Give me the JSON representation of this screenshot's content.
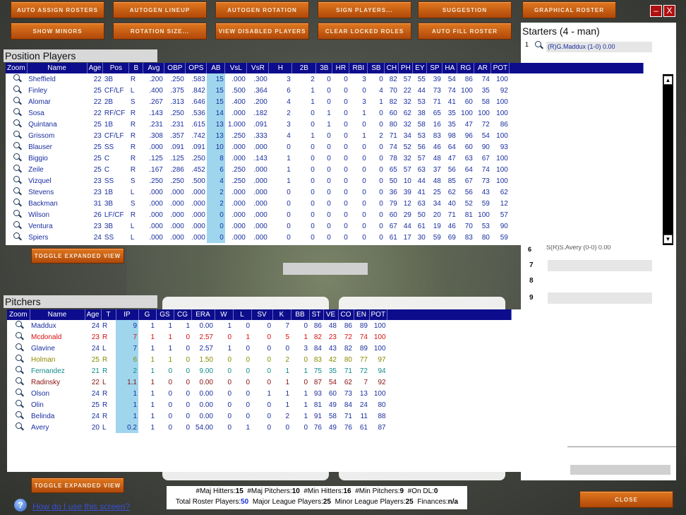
{
  "toolbar": {
    "auto_assign": "Auto Assign Rosters",
    "autogen_lineup": "Autogen Lineup",
    "autogen_rotation": "Autogen Rotation",
    "sign_players": "Sign Players...",
    "suggestion": "Suggestion",
    "graphical_roster": "Graphical Roster",
    "show_minors": "Show Minors",
    "rotation_size": "Rotation Size...",
    "view_disabled": "View Disabled Players",
    "clear_locked": "Clear Locked Roles",
    "auto_fill": "Auto Fill Roster",
    "minimize": "–",
    "close_x": "X"
  },
  "starters": {
    "title": "Starters (4 - man)",
    "first_num": "1",
    "first_text": "(R)G.Maddux  (1-0) 0.00",
    "sixth_num": "6",
    "sixth_text": "S(R)S.Avery  (0-0) 0.00",
    "slots": [
      "7",
      "8",
      "9"
    ]
  },
  "position": {
    "title": "Position Players",
    "headers": [
      "Zoom",
      "Name",
      "Age",
      "Pos",
      "B",
      "Avg",
      "OBP",
      "OPS",
      "AB",
      "VsL",
      "VsR",
      "H",
      "2B",
      "3B",
      "HR",
      "RBI",
      "SB",
      "CH",
      "PH",
      "EY",
      "SP",
      "HA",
      "RG",
      "AR",
      "POT"
    ],
    "rows": [
      [
        "Sheffield",
        "22",
        "3B",
        "R",
        ".200",
        ".250",
        ".583",
        "15",
        ".000",
        ".300",
        "3",
        "2",
        "0",
        "0",
        "3",
        "0",
        "82",
        "57",
        "55",
        "39",
        "54",
        "86",
        "74",
        "100"
      ],
      [
        "Finley",
        "25",
        "CF/LF",
        "L",
        ".400",
        ".375",
        ".842",
        "15",
        ".500",
        ".364",
        "6",
        "1",
        "0",
        "0",
        "0",
        "4",
        "70",
        "22",
        "44",
        "73",
        "74",
        "100",
        "35",
        "92"
      ],
      [
        "Alomar",
        "22",
        "2B",
        "S",
        ".267",
        ".313",
        ".646",
        "15",
        ".400",
        ".200",
        "4",
        "1",
        "0",
        "0",
        "3",
        "1",
        "82",
        "32",
        "53",
        "71",
        "41",
        "60",
        "58",
        "100"
      ],
      [
        "Sosa",
        "22",
        "RF/CF",
        "R",
        ".143",
        ".250",
        ".536",
        "14",
        ".000",
        ".182",
        "2",
        "0",
        "1",
        "0",
        "1",
        "0",
        "60",
        "62",
        "38",
        "65",
        "35",
        "100",
        "100",
        "100"
      ],
      [
        "Quintana",
        "25",
        "1B",
        "R",
        ".231",
        ".231",
        ".615",
        "13",
        "1.000",
        ".091",
        "3",
        "0",
        "1",
        "0",
        "0",
        "0",
        "80",
        "32",
        "58",
        "16",
        "35",
        "47",
        "72",
        "86"
      ],
      [
        "Grissom",
        "23",
        "CF/LF",
        "R",
        ".308",
        ".357",
        ".742",
        "13",
        ".250",
        ".333",
        "4",
        "1",
        "0",
        "0",
        "1",
        "2",
        "71",
        "34",
        "53",
        "83",
        "98",
        "96",
        "54",
        "100"
      ],
      [
        "Blauser",
        "25",
        "SS",
        "R",
        ".000",
        ".091",
        ".091",
        "10",
        ".000",
        ".000",
        "0",
        "0",
        "0",
        "0",
        "0",
        "0",
        "74",
        "52",
        "56",
        "46",
        "64",
        "60",
        "90",
        "93"
      ],
      [
        "Biggio",
        "25",
        "C",
        "R",
        ".125",
        ".125",
        ".250",
        "8",
        ".000",
        ".143",
        "1",
        "0",
        "0",
        "0",
        "0",
        "0",
        "78",
        "32",
        "57",
        "48",
        "47",
        "63",
        "67",
        "100"
      ],
      [
        "Zeile",
        "25",
        "C",
        "R",
        ".167",
        ".286",
        ".452",
        "6",
        ".250",
        ".000",
        "1",
        "0",
        "0",
        "0",
        "0",
        "0",
        "65",
        "57",
        "63",
        "37",
        "56",
        "64",
        "74",
        "100"
      ],
      [
        "Vizquel",
        "23",
        "SS",
        "S",
        ".250",
        ".250",
        ".500",
        "4",
        ".250",
        ".000",
        "1",
        "0",
        "0",
        "0",
        "0",
        "0",
        "50",
        "10",
        "44",
        "48",
        "85",
        "67",
        "73",
        "100"
      ],
      [
        "Stevens",
        "23",
        "1B",
        "L",
        ".000",
        ".000",
        ".000",
        "2",
        ".000",
        ".000",
        "0",
        "0",
        "0",
        "0",
        "0",
        "0",
        "36",
        "39",
        "41",
        "25",
        "62",
        "56",
        "43",
        "62"
      ],
      [
        "Backman",
        "31",
        "3B",
        "S",
        ".000",
        ".000",
        ".000",
        "2",
        ".000",
        ".000",
        "0",
        "0",
        "0",
        "0",
        "0",
        "0",
        "79",
        "12",
        "63",
        "34",
        "40",
        "52",
        "59",
        "12"
      ],
      [
        "Wilson",
        "26",
        "LF/CF",
        "R",
        ".000",
        ".000",
        ".000",
        "0",
        ".000",
        ".000",
        "0",
        "0",
        "0",
        "0",
        "0",
        "0",
        "60",
        "29",
        "50",
        "20",
        "71",
        "81",
        "100",
        "57"
      ],
      [
        "Ventura",
        "23",
        "3B",
        "L",
        ".000",
        ".000",
        ".000",
        "0",
        ".000",
        ".000",
        "0",
        "0",
        "0",
        "0",
        "0",
        "0",
        "67",
        "44",
        "61",
        "19",
        "46",
        "70",
        "53",
        "90"
      ],
      [
        "Spiers",
        "24",
        "SS",
        "L",
        ".000",
        ".000",
        ".000",
        "0",
        ".000",
        ".000",
        "0",
        "0",
        "0",
        "0",
        "0",
        "0",
        "61",
        "17",
        "30",
        "59",
        "69",
        "83",
        "80",
        "59"
      ]
    ],
    "toggle": "Toggle Expanded View"
  },
  "pitchers": {
    "title": "Pitchers",
    "headers": [
      "Zoom",
      "Name",
      "Age",
      "T",
      "IP",
      "G",
      "GS",
      "CG",
      "ERA",
      "W",
      "L",
      "SV",
      "K",
      "BB",
      "ST",
      "VE",
      "CO",
      "EN",
      "POT"
    ],
    "rows": [
      [
        "Maddux",
        "24",
        "R",
        "9",
        "1",
        "1",
        "1",
        "0.00",
        "1",
        "0",
        "0",
        "7",
        "0",
        "86",
        "48",
        "86",
        "89",
        "100"
      ],
      [
        "Mcdonald",
        "23",
        "R",
        "7",
        "1",
        "1",
        "0",
        "2.57",
        "0",
        "1",
        "0",
        "5",
        "1",
        "82",
        "23",
        "72",
        "74",
        "100"
      ],
      [
        "Glavine",
        "24",
        "L",
        "7",
        "1",
        "1",
        "0",
        "2.57",
        "1",
        "0",
        "0",
        "0",
        "3",
        "84",
        "43",
        "82",
        "89",
        "100"
      ],
      [
        "Holman",
        "25",
        "R",
        "6",
        "1",
        "1",
        "0",
        "1.50",
        "0",
        "0",
        "0",
        "2",
        "0",
        "83",
        "42",
        "80",
        "77",
        "97"
      ],
      [
        "Fernandez",
        "21",
        "R",
        "2",
        "1",
        "0",
        "0",
        "9.00",
        "0",
        "0",
        "0",
        "1",
        "1",
        "75",
        "35",
        "71",
        "72",
        "94"
      ],
      [
        "Radinsky",
        "22",
        "L",
        "1.1",
        "1",
        "0",
        "0",
        "0.00",
        "0",
        "0",
        "0",
        "1",
        "0",
        "87",
        "54",
        "62",
        "7",
        "92"
      ],
      [
        "Olson",
        "24",
        "R",
        "1",
        "1",
        "0",
        "0",
        "0.00",
        "0",
        "0",
        "1",
        "1",
        "1",
        "93",
        "60",
        "73",
        "13",
        "100"
      ],
      [
        "Olin",
        "25",
        "R",
        "1",
        "1",
        "0",
        "0",
        "0.00",
        "0",
        "0",
        "0",
        "1",
        "1",
        "81",
        "49",
        "84",
        "24",
        "80"
      ],
      [
        "Belinda",
        "24",
        "R",
        "1",
        "1",
        "0",
        "0",
        "0.00",
        "0",
        "0",
        "0",
        "2",
        "1",
        "91",
        "58",
        "71",
        "11",
        "88"
      ],
      [
        "Avery",
        "20",
        "L",
        "0.2",
        "1",
        "0",
        "0",
        "54.00",
        "0",
        "1",
        "0",
        "0",
        "0",
        "76",
        "49",
        "76",
        "61",
        "87"
      ]
    ],
    "row_colors": [
      "#1a2fa0",
      "#d81010",
      "#1a2fa0",
      "#8a8a00",
      "#108a8a",
      "#8a1010",
      "#1a2fa0",
      "#1a2fa0",
      "#1a2fa0",
      "#1a2fa0"
    ],
    "toggle": "Toggle Expanded View"
  },
  "summary": {
    "maj_hitters_label": "#Maj Hitters:",
    "maj_hitters": "15",
    "maj_pitchers_label": "#Maj Pitchers:",
    "maj_pitchers": "10",
    "min_hitters_label": "#Min Hitters:",
    "min_hitters": "16",
    "min_pitchers_label": "#Min Pitchers:",
    "min_pitchers": "9",
    "on_dl_label": "#On DL:",
    "on_dl": "0",
    "total_label": "Total Roster Players:",
    "total": "50",
    "major_label": "Major League Players:",
    "major": "25",
    "minor_label": "Minor League Players:",
    "minor": "25",
    "finances_label": "Finances:",
    "finances": "n/a"
  },
  "help": {
    "link": "How do I use this screen?",
    "icon": "?"
  },
  "close_button": "Close"
}
